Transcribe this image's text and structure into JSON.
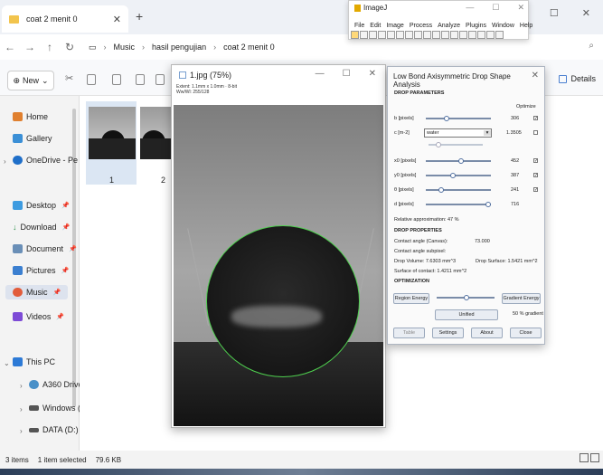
{
  "explorer": {
    "tab_title": "coat 2 menit 0",
    "breadcrumbs": [
      "Music",
      "hasil pengujian",
      "coat 2 menit 0"
    ],
    "new_label": "New",
    "details_label": "Details",
    "sidebar": [
      {
        "label": "Home",
        "icon": "home-icon"
      },
      {
        "label": "Gallery",
        "icon": "gallery-icon"
      },
      {
        "label": "OneDrive - Pe",
        "icon": "cloud-icon"
      },
      {
        "label": "Desktop",
        "icon": "desktop-icon"
      },
      {
        "label": "Download",
        "icon": "download-icon"
      },
      {
        "label": "Document",
        "icon": "document-icon"
      },
      {
        "label": "Pictures",
        "icon": "pictures-icon"
      },
      {
        "label": "Music",
        "icon": "music-icon"
      },
      {
        "label": "Videos",
        "icon": "videos-icon"
      },
      {
        "label": "This PC",
        "icon": "pc-icon"
      },
      {
        "label": "A360 Drive",
        "icon": "drive-icon"
      },
      {
        "label": "Windows (C",
        "icon": "windows-drive-icon"
      },
      {
        "label": "DATA (D:)",
        "icon": "data-drive-icon"
      }
    ],
    "files": [
      {
        "label": "1"
      },
      {
        "label": "2"
      }
    ],
    "status": {
      "items": "3 items",
      "selected": "1 item selected",
      "size": "79.6 KB"
    }
  },
  "imagej": {
    "title": "ImageJ",
    "menu": [
      "File",
      "Edit",
      "Image",
      "Process",
      "Analyze",
      "Plugins",
      "Window",
      "Help"
    ]
  },
  "image_window": {
    "title": "1.jpg (75%)",
    "info_line1": "Extent: 1.1mm x 1.0mm · 8-bit",
    "info_line2": "Ww/Wl: 255/128"
  },
  "dialog": {
    "title": "Low Bond Axisymmetric Drop Shape Analysis",
    "section_params": "DROP PARAMETERS",
    "optimize_label": "Optimize",
    "params": [
      {
        "label": "b [pixels]",
        "value": "306",
        "checked": true
      },
      {
        "label": "c [m-2]",
        "value": "1.3505",
        "checked": false
      },
      {
        "label": "x0 [pixels]",
        "value": "452",
        "checked": true
      },
      {
        "label": "y0 [pixels]",
        "value": "387",
        "checked": true
      },
      {
        "label": "θ [pixels]",
        "value": "241",
        "checked": true
      },
      {
        "label": "d [pixels]",
        "value": "716",
        "checked": false
      }
    ],
    "fluid": "water",
    "rel_approx": "Relative approximation: 47 %",
    "section_props": "DROP PROPERTIES",
    "contact_angle_label": "Contact angle (Canvas):",
    "contact_angle_value": "73.000",
    "contact_angle_sub": "Contact angle subpixel:",
    "drop_volume": "Drop Volume: 7.6303 mm^3",
    "drop_surface": "Drop Surface: 1.5421 mm^2",
    "surface_contact": "Surface of contact: 1.4211 mm^2",
    "section_opt": "OPTIMIZATION",
    "region_energy": "Region Energy",
    "gradient_energy": "Gradient Energy",
    "unified": "Unified",
    "gradient_pct": "50 % gradient",
    "buttons": [
      "Table",
      "Settings",
      "About",
      "Close"
    ]
  }
}
